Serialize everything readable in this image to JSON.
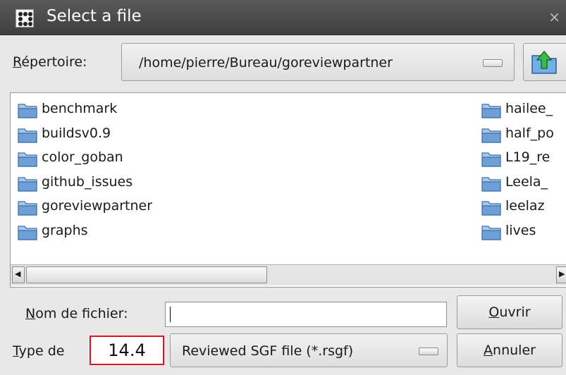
{
  "window": {
    "title": "Select a file",
    "close_glyph": "×"
  },
  "directory": {
    "label_prefix": "R",
    "label_rest": "épertoire:",
    "path": "/home/pierre/Bureau/goreviewpartner"
  },
  "files_left": [
    "benchmark",
    "buildsv0.9",
    "color_goban",
    "github_issues",
    "goreviewpartner",
    "graphs"
  ],
  "files_right": [
    "hailee_",
    "half_po",
    "L19_re",
    "Leela_",
    "leelaz",
    "lives"
  ],
  "scroll": {
    "left_arrow": "◀",
    "right_arrow": "▶"
  },
  "filename": {
    "label_prefix": "N",
    "label_rest": "om de fichier:",
    "value": ""
  },
  "filetype": {
    "label_prefix": "T",
    "label_rest": "ype de",
    "selected": "Reviewed SGF file (*.rsgf)"
  },
  "badge_value": "14.4",
  "buttons": {
    "open_prefix": "O",
    "open_rest": "uvrir",
    "cancel_prefix": "A",
    "cancel_rest": "nnuler"
  },
  "colors": {
    "folder_blue": "#6e9fd6",
    "badge_border": "#e2131b",
    "titlebar": "#4a4a4a"
  },
  "icons": {
    "folder": "folder-icon",
    "up": "folder-up-icon",
    "app": "go-board-icon"
  }
}
